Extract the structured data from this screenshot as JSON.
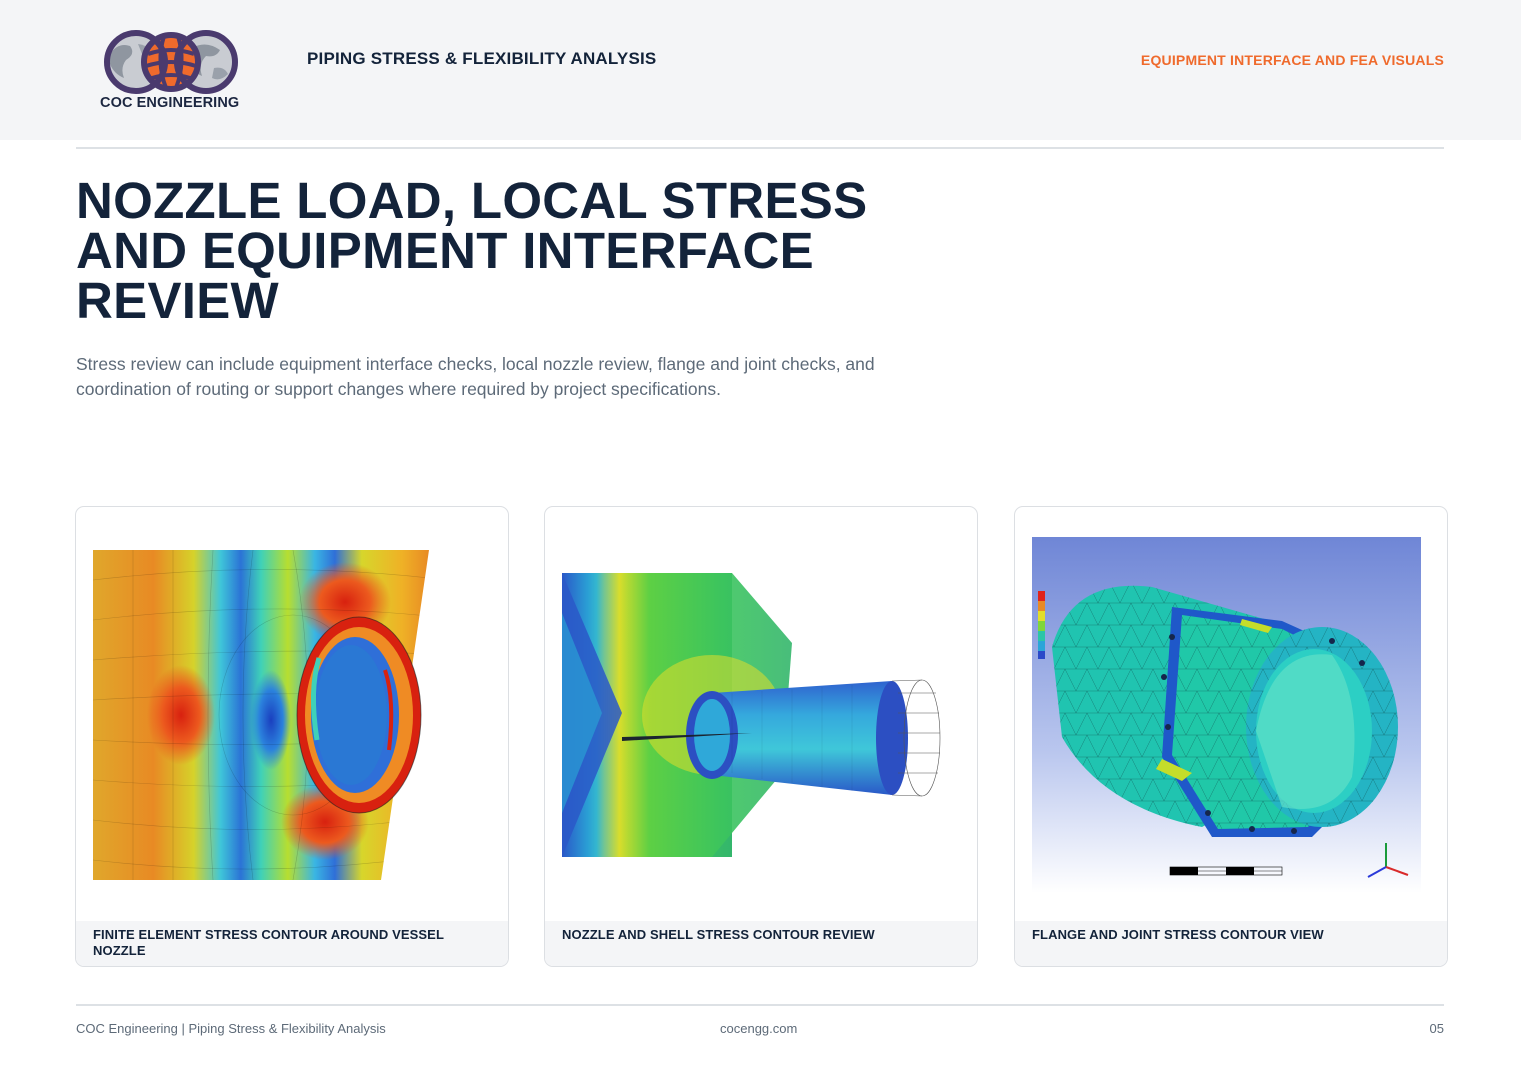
{
  "header": {
    "logo_text": "COC ENGINEERING",
    "title": "PIPING STRESS & FLEXIBILITY ANALYSIS",
    "section_label": "EQUIPMENT INTERFACE AND FEA VISUALS"
  },
  "main": {
    "title": "NOZZLE LOAD, LOCAL STRESS AND EQUIPMENT INTERFACE REVIEW",
    "intro": "Stress review can include equipment interface checks, local nozzle review, flange and joint checks, and coordination of routing or support changes where required by project specifications."
  },
  "cards": [
    {
      "caption": "FINITE ELEMENT STRESS CONTOUR AROUND VESSEL NOZZLE",
      "image": "fea-vessel-nozzle-contour"
    },
    {
      "caption": "NOZZLE AND SHELL STRESS CONTOUR REVIEW",
      "image": "fea-nozzle-shell-contour"
    },
    {
      "caption": "FLANGE AND JOINT STRESS CONTOUR VIEW",
      "image": "fea-flange-joint-contour"
    }
  ],
  "footer": {
    "left": "COC Engineering | Piping Stress & Flexibility Analysis",
    "center": "cocengg.com",
    "page_number": "05"
  },
  "colors": {
    "navy": "#13233a",
    "accent_orange": "#ef6a2c",
    "muted_text": "#5d6a78",
    "header_bg": "#f4f5f7",
    "logo_purple": "#4a3a6e"
  }
}
